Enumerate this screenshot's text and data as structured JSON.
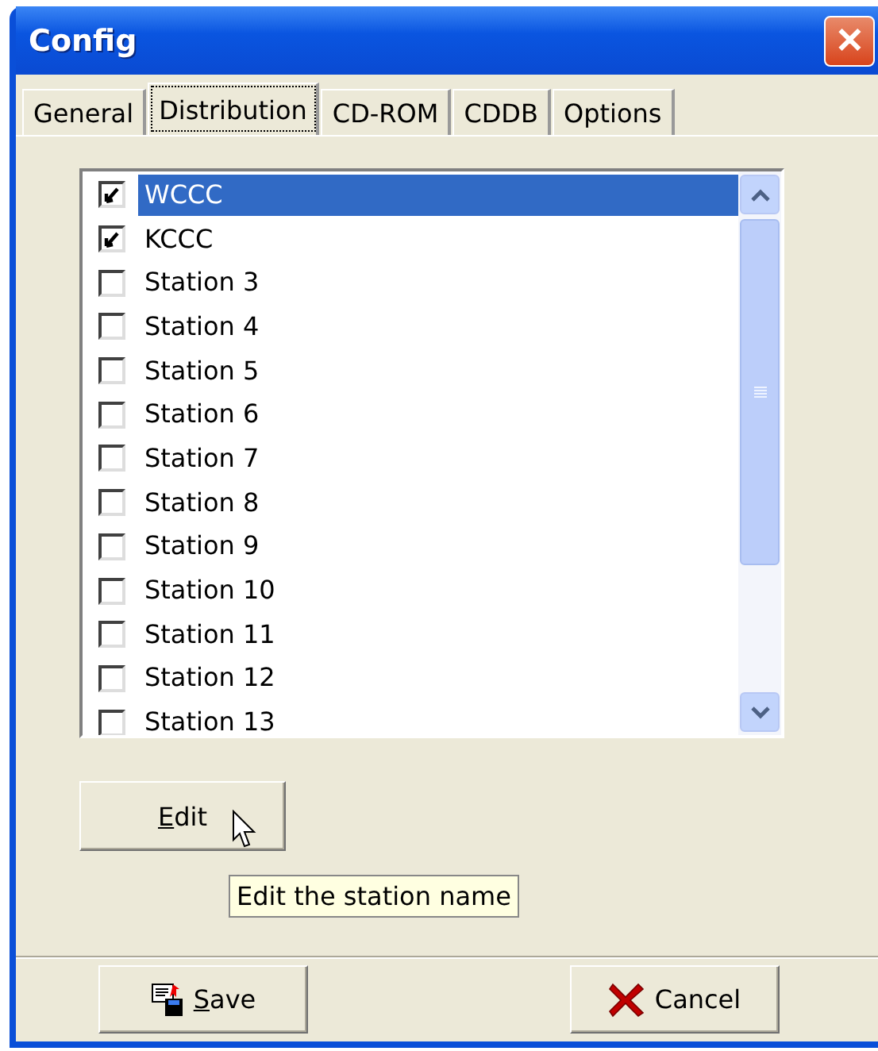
{
  "window": {
    "title": "Config",
    "close": "✕"
  },
  "tabs": [
    {
      "label": "General",
      "selected": false
    },
    {
      "label": "Distribution",
      "selected": true
    },
    {
      "label": "CD-ROM",
      "selected": false
    },
    {
      "label": "CDDB",
      "selected": false
    },
    {
      "label": "Options",
      "selected": false
    }
  ],
  "stations": [
    {
      "name": "WCCC",
      "checked": true,
      "selected": true
    },
    {
      "name": "KCCC",
      "checked": true,
      "selected": false
    },
    {
      "name": "Station 3",
      "checked": false,
      "selected": false
    },
    {
      "name": "Station 4",
      "checked": false,
      "selected": false
    },
    {
      "name": "Station 5",
      "checked": false,
      "selected": false
    },
    {
      "name": "Station 6",
      "checked": false,
      "selected": false
    },
    {
      "name": "Station 7",
      "checked": false,
      "selected": false
    },
    {
      "name": "Station 8",
      "checked": false,
      "selected": false
    },
    {
      "name": "Station 9",
      "checked": false,
      "selected": false
    },
    {
      "name": "Station 10",
      "checked": false,
      "selected": false
    },
    {
      "name": "Station 11",
      "checked": false,
      "selected": false
    },
    {
      "name": "Station 12",
      "checked": false,
      "selected": false
    },
    {
      "name": "Station 13",
      "checked": false,
      "selected": false
    }
  ],
  "edit_button": {
    "label": "Edit",
    "underline_first": true
  },
  "tooltip": "Edit the station name",
  "footer_buttons": [
    {
      "kind": "save",
      "label": "Save",
      "underline_first": true
    },
    {
      "kind": "cancel",
      "label": "Cancel",
      "underline_first": false
    }
  ]
}
